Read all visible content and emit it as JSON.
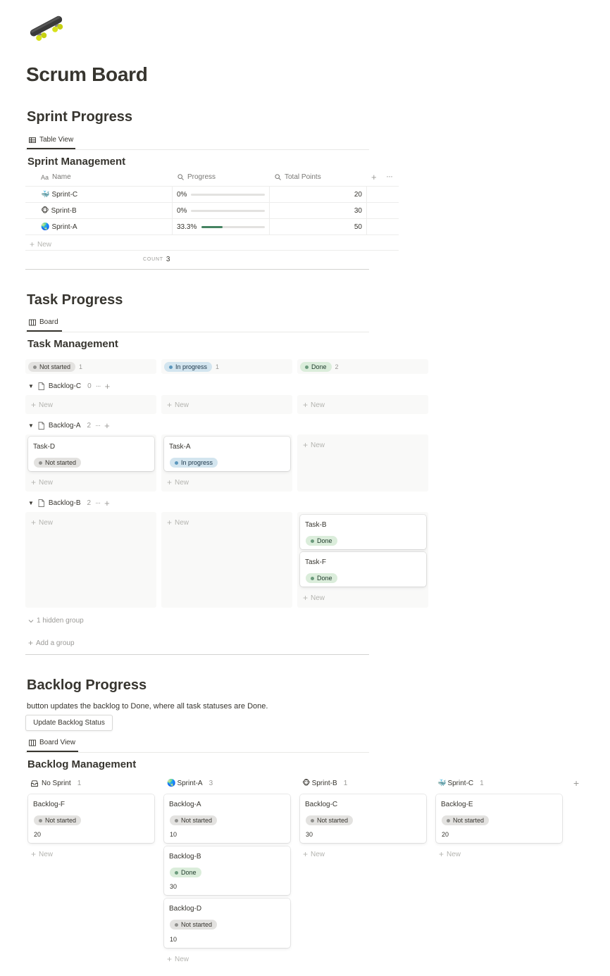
{
  "page": {
    "icon": "skateboard-icon",
    "title": "Scrum Board"
  },
  "sprint_section": {
    "heading": "Sprint Progress",
    "view_tab": "Table View",
    "db_title": "Sprint Management",
    "columns": [
      "Name",
      "Progress",
      "Total Points"
    ],
    "rows": [
      {
        "emoji": "🐳",
        "name": "Sprint-C",
        "progress_label": "0%",
        "progress": 0,
        "points": "20"
      },
      {
        "emoji": "🐵",
        "name": "Sprint-B",
        "progress_label": "0%",
        "progress": 0,
        "points": "30"
      },
      {
        "emoji": "🌏",
        "name": "Sprint-A",
        "progress_label": "33.3%",
        "progress": 0.333,
        "points": "50"
      }
    ],
    "new_label": "New",
    "count_label": "COUNT",
    "count_value": "3"
  },
  "task_section": {
    "heading": "Task Progress",
    "view_tab": "Board",
    "db_title": "Task Management",
    "statuses": [
      {
        "label": "Not started",
        "count": "1"
      },
      {
        "label": "In progress",
        "count": "1"
      },
      {
        "label": "Done",
        "count": "2"
      }
    ],
    "groups": [
      {
        "name": "Backlog-C",
        "count": "0"
      },
      {
        "name": "Backlog-A",
        "count": "2"
      },
      {
        "name": "Backlog-B",
        "count": "2"
      }
    ],
    "cards": {
      "task_d": {
        "title": "Task-D",
        "status": "Not started"
      },
      "task_a": {
        "title": "Task-A",
        "status": "In progress"
      },
      "task_b": {
        "title": "Task-B",
        "status": "Done"
      },
      "task_f": {
        "title": "Task-F",
        "status": "Done"
      }
    },
    "new_label": "New",
    "hidden_group": "1 hidden group",
    "add_group": "Add a group"
  },
  "backlog_section": {
    "heading": "Backlog Progress",
    "description": "button updates the backlog to Done, where all task statuses are Done.",
    "button_label": "Update Backlog Status",
    "view_tab": "Board View",
    "db_title": "Backlog Management",
    "columns": [
      {
        "icon": "inbox-icon",
        "emoji": "",
        "title": "No Sprint",
        "count": "1"
      },
      {
        "icon": "",
        "emoji": "🌏",
        "title": "Sprint-A",
        "count": "3"
      },
      {
        "icon": "",
        "emoji": "🐵",
        "title": "Sprint-B",
        "count": "1"
      },
      {
        "icon": "",
        "emoji": "🐳",
        "title": "Sprint-C",
        "count": "1"
      }
    ],
    "cards": {
      "backlog_f": {
        "title": "Backlog-F",
        "status": "Not started",
        "points": "20"
      },
      "backlog_a": {
        "title": "Backlog-A",
        "status": "Not started",
        "points": "10"
      },
      "backlog_b": {
        "title": "Backlog-B",
        "status": "Done",
        "points": "30"
      },
      "backlog_d": {
        "title": "Backlog-D",
        "status": "Not started",
        "points": "10"
      },
      "backlog_c": {
        "title": "Backlog-C",
        "status": "Not started",
        "points": "30"
      },
      "backlog_e": {
        "title": "Backlog-E",
        "status": "Not started",
        "points": "20"
      }
    },
    "new_label": "New"
  },
  "colors": {
    "text": "#37352f",
    "muted": "#9b9a97",
    "grey_pill": "#e3e2e0",
    "blue_pill": "#d3e5ef",
    "green_pill": "#dbeddb",
    "progress_fill": "#448361"
  }
}
